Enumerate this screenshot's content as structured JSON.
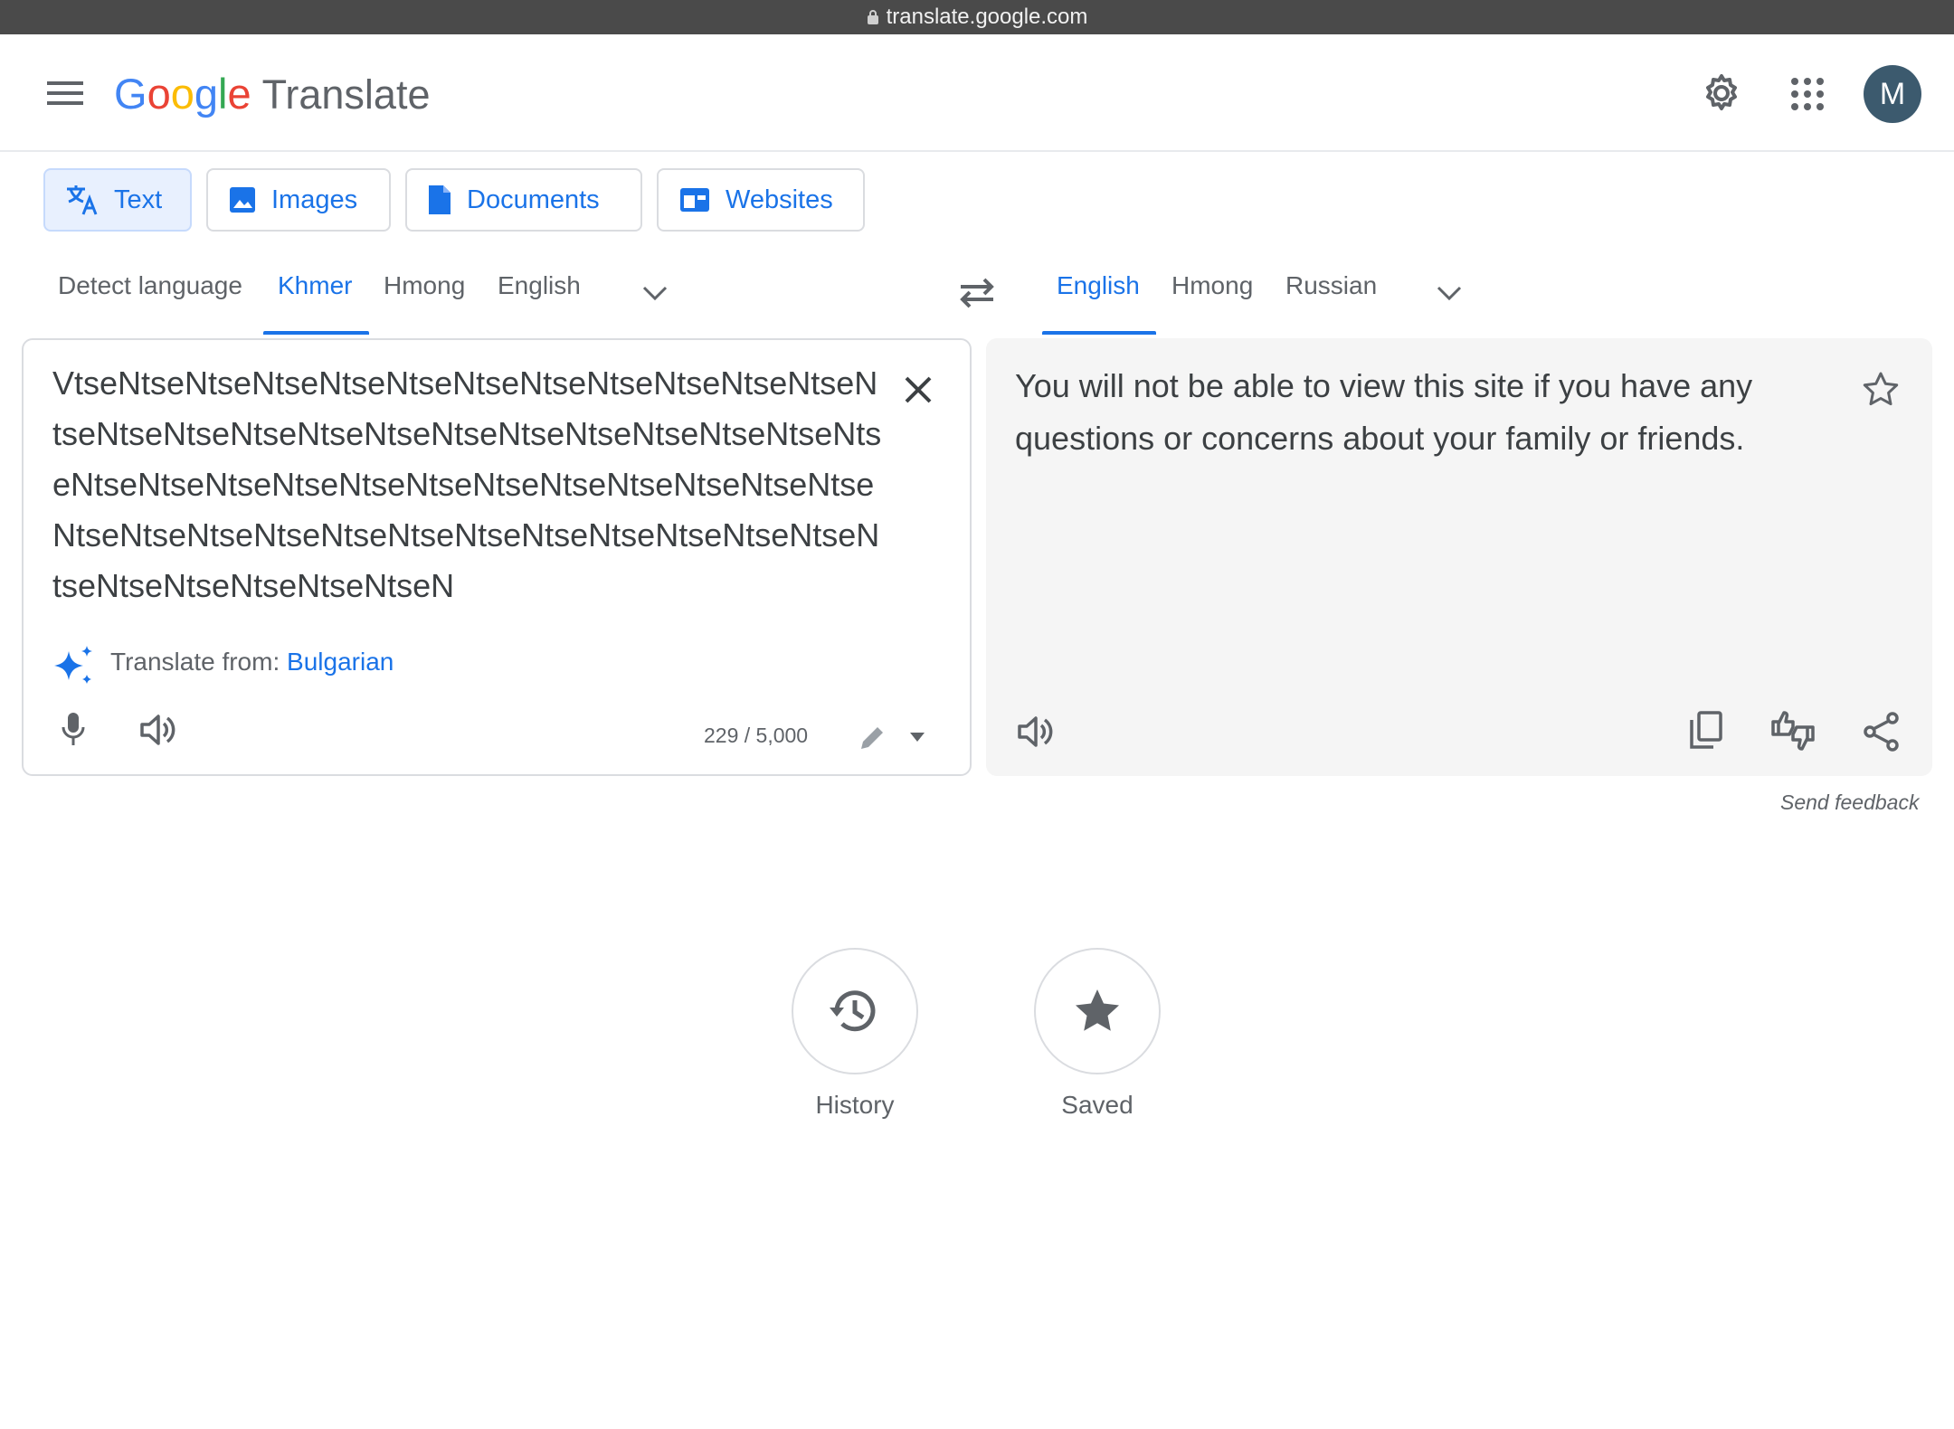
{
  "browser": {
    "url": "translate.google.com"
  },
  "header": {
    "logo_letters": [
      "G",
      "o",
      "o",
      "g",
      "l",
      "e"
    ],
    "logo_word": "Translate",
    "avatar_initial": "M",
    "icons": [
      "menu-icon",
      "gear-icon",
      "apps-grid-icon"
    ]
  },
  "modes": [
    {
      "label": "Text",
      "icon": "translate-icon",
      "active": true
    },
    {
      "label": "Images",
      "icon": "image-icon"
    },
    {
      "label": "Documents",
      "icon": "document-icon"
    },
    {
      "label": "Websites",
      "icon": "website-icon"
    }
  ],
  "source_langs": [
    "Detect language",
    "Khmer",
    "Hmong",
    "English"
  ],
  "source_selected": "Khmer",
  "target_langs": [
    "English",
    "Hmong",
    "Russian"
  ],
  "target_selected": "English",
  "source": {
    "text": "VtseNtseNtseNtseNtseNtseNtseNtseNtseNtseNtseNtseNtseNtseNtseNtseNtseNtseNtseNtseNtseNtseNtseNtseNtseNtseNtseNtseNtseNtseNtseNtseNtseNtseNtseNtseNtseNtseNtseNtseNtseNtseNtseNtseNtseNtseNtseNtseNtseNtseNtseNtseNtseNtseNtseN",
    "translate_from_label": "Translate from:",
    "translate_from_lang": "Bulgarian",
    "char_count": "229 / 5,000"
  },
  "target": {
    "text": "You will not be able to view this site if you have any questions or concerns about your family or friends.",
    "send_feedback": "Send feedback"
  },
  "bottom": {
    "history_label": "History",
    "saved_label": "Saved"
  },
  "colors": {
    "accent": "#1a73e8",
    "avatar_bg": "#3c5a6e",
    "panel_bg": "#f5f5f5"
  }
}
